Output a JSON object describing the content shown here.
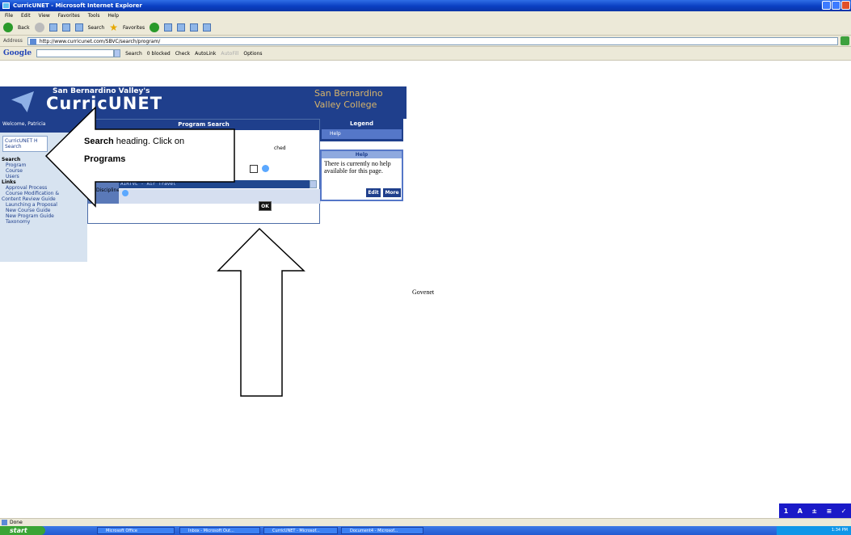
{
  "window": {
    "title": "CurricUNET - Microsoft Internet Explorer"
  },
  "menu": [
    "File",
    "Edit",
    "View",
    "Favorites",
    "Tools",
    "Help"
  ],
  "toolbar": {
    "back": "Back",
    "search": "Search",
    "favorites": "Favorites"
  },
  "address": {
    "label": "Address",
    "url": "http://www.curricunet.com/SBVC/search/program/"
  },
  "google": {
    "logo": "Google",
    "search": "Search",
    "blocked": "0 blocked",
    "check": "Check",
    "autolink": "AutoLink",
    "autofill": "AutoFill",
    "options": "Options"
  },
  "banner": {
    "line1": "San Bernardino Valley's",
    "line2": "CurricUNET",
    "right": "San Bernardino Valley College"
  },
  "welcome": "Welcome, Patricia",
  "sidebar": {
    "box_line1": "CurricUNET H",
    "box_line2": "Search",
    "sections": [
      {
        "heading": "Search",
        "items": [
          "Program",
          "Course",
          "Users"
        ]
      },
      {
        "heading": "Links",
        "items": [
          "Approval Process",
          "Course Modification &"
        ]
      },
      {
        "heading": "Content Review Guide",
        "items": [
          "Launching a Proposal",
          "New Course Guide",
          "New Program Guide",
          "Taxonomy"
        ]
      }
    ]
  },
  "program_search": {
    "heading": "Program Search",
    "searched_text": "ched",
    "discipline_label": "Discipline",
    "selected_discipline": "AIRTVL - Air Travel",
    "ok_label": "OK"
  },
  "legend": {
    "heading": "Legend",
    "help": "Help"
  },
  "help": {
    "heading": "Help",
    "text": "There is currently no help available for this page.",
    "edit": "Edit",
    "more": "More"
  },
  "callout": {
    "bold1": "Search",
    "text1": " heading. Click on",
    "bold2": "Programs"
  },
  "body_text": "Govenet",
  "status": "Done",
  "taskbar": {
    "start": "start",
    "tasks": [
      "Microsoft Office",
      "Inbox - Microsoft Out...",
      "CurricUNET - Microsof...",
      "Document4 - Microsof..."
    ],
    "clock": "1:34 PM"
  },
  "langbar": [
    "1",
    "A",
    "±",
    "≡",
    "✓"
  ]
}
